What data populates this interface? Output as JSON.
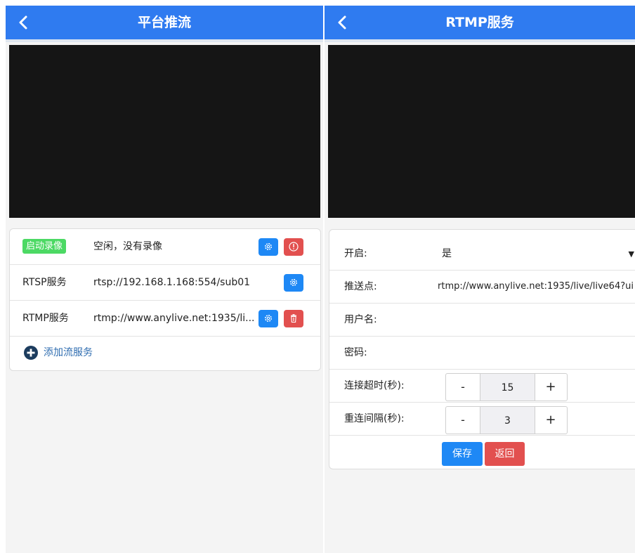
{
  "left": {
    "header": {
      "title": "平台推流"
    },
    "streams": [
      {
        "label": "启动录像",
        "value": "空闲，没有录像"
      },
      {
        "label": "RTSP服务",
        "value": "rtsp://192.168.1.168:554/sub01"
      },
      {
        "label": "RTMP服务",
        "value": "rtmp://www.anylive.net:1935/li..."
      }
    ],
    "add_label": "添加流服务"
  },
  "right": {
    "header": {
      "title": "RTMP服务"
    },
    "fields": {
      "enable": {
        "label": "开启:",
        "value": "是"
      },
      "push_point": {
        "label": "推送点:",
        "value": "rtmp://www.anylive.net:1935/live/live64?ui"
      },
      "username": {
        "label": "用户名:",
        "value": ""
      },
      "password": {
        "label": "密码:",
        "value": ""
      },
      "timeout": {
        "label": "连接超时(秒):",
        "minus": "-",
        "value": "15",
        "plus": "+"
      },
      "interval": {
        "label": "重连间隔(秒):",
        "minus": "-",
        "value": "3",
        "plus": "+"
      }
    },
    "save_label": "保存",
    "back_label": "返回"
  },
  "colors": {
    "header": "#2f7bf0",
    "blue_button": "#1e88f5",
    "red_button": "#e2504f",
    "badge": "#4cd964"
  },
  "icons": [
    "chevron-left-icon",
    "gear-icon",
    "info-icon",
    "trash-icon",
    "plus-circle-icon",
    "caret-down-icon"
  ]
}
